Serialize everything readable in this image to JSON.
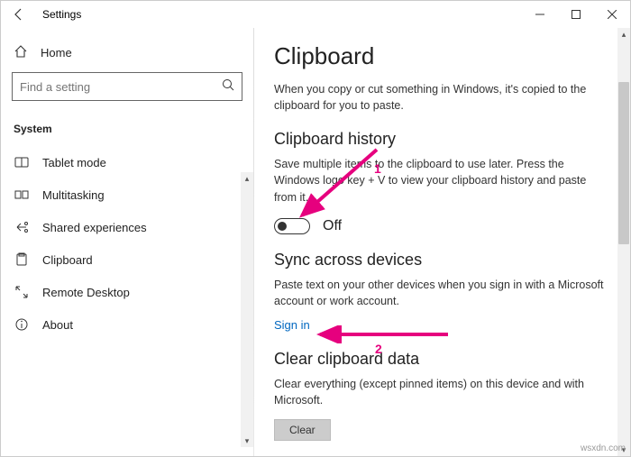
{
  "titlebar": {
    "title": "Settings"
  },
  "sidebar": {
    "home": "Home",
    "search": {
      "placeholder": "Find a setting"
    },
    "category": "System",
    "items": [
      {
        "label": "Tablet mode"
      },
      {
        "label": "Multitasking"
      },
      {
        "label": "Shared experiences"
      },
      {
        "label": "Clipboard"
      },
      {
        "label": "Remote Desktop"
      },
      {
        "label": "About"
      }
    ]
  },
  "page": {
    "heading": "Clipboard",
    "intro": "When you copy or cut something in Windows, it's copied to the clipboard for you to paste.",
    "history": {
      "heading": "Clipboard history",
      "desc": "Save multiple items to the clipboard to use later. Press the Windows logo key + V to view your clipboard history and paste from it.",
      "toggle_label": "Off"
    },
    "sync": {
      "heading": "Sync across devices",
      "desc": "Paste text on your other devices when you sign in with a Microsoft account or work account.",
      "link": "Sign in"
    },
    "clear": {
      "heading": "Clear clipboard data",
      "desc": "Clear everything (except pinned items) on this device and with Microsoft.",
      "button": "Clear"
    }
  },
  "annotations": {
    "num1": "1",
    "num2": "2"
  },
  "watermark": "wsxdn.com"
}
